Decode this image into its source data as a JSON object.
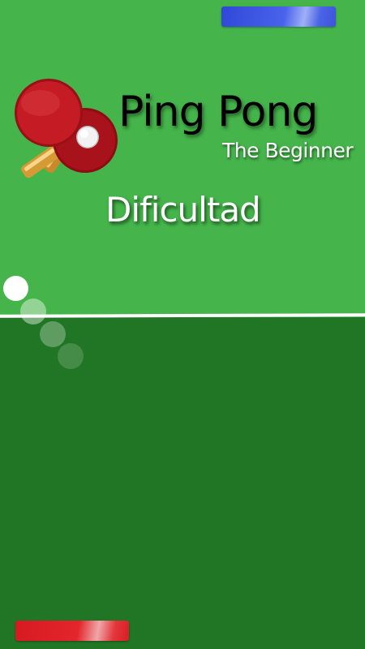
{
  "game": {
    "title": "Ping Pong",
    "subtitle": "The Beginner",
    "menu_label": "Dificultad"
  },
  "players": {
    "top_paddle_color": "#3a55e2",
    "bottom_paddle_color": "#dc2027"
  },
  "colors": {
    "field_top": "#45b54b",
    "field_bottom": "#217626",
    "net_line": "#ffffff",
    "ball": "#ffffff"
  },
  "icons": {
    "logo": "ping-pong-paddles-icon"
  }
}
